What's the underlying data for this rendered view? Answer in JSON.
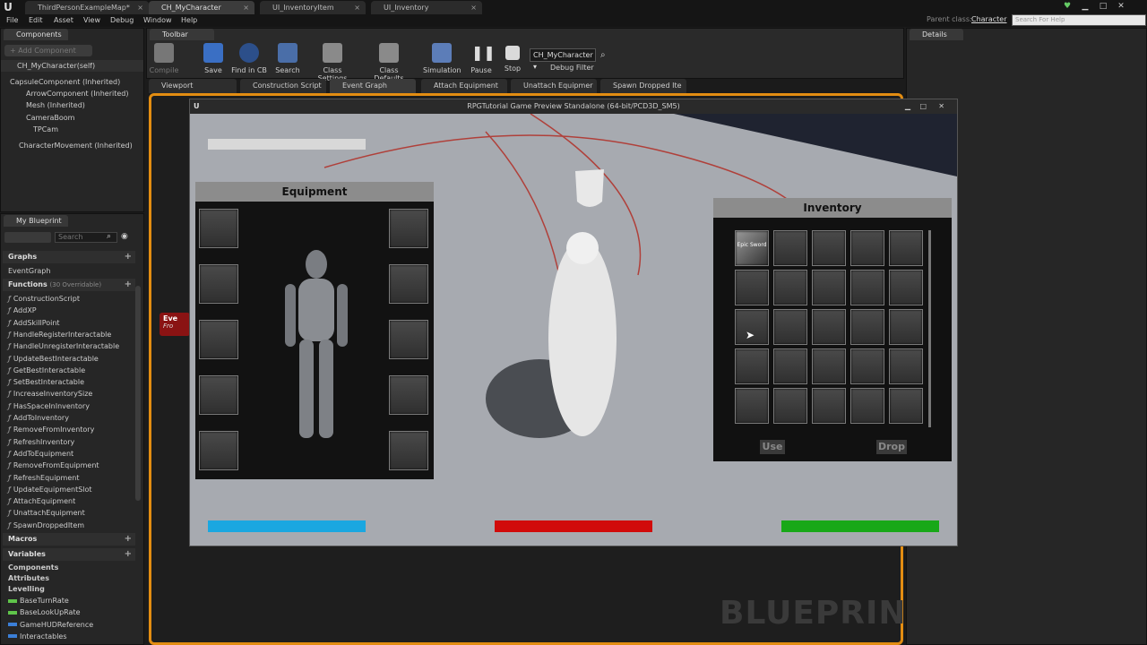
{
  "app": {
    "doc_tabs": [
      "ThirdPersonExampleMap*",
      "CH_MyCharacter",
      "UI_InventoryItem",
      "UI_Inventory"
    ],
    "menu": [
      "File",
      "Edit",
      "Asset",
      "View",
      "Debug",
      "Window",
      "Help"
    ],
    "parent_class_label": "Parent class:",
    "parent_class_value": "Character",
    "help_search_placeholder": "Search For Help"
  },
  "components_panel": {
    "tab": "Components",
    "add_button": "+ Add Component",
    "self_item": "CH_MyCharacter(self)",
    "tree": [
      {
        "label": "CapsuleComponent (Inherited)"
      },
      {
        "label": "ArrowComponent (Inherited)"
      },
      {
        "label": "Mesh (Inherited)"
      },
      {
        "label": "CameraBoom"
      },
      {
        "label": "TPCam"
      },
      {
        "label": "CharacterMovement (Inherited)"
      }
    ]
  },
  "toolbar": {
    "tab": "Toolbar",
    "buttons": [
      "Compile",
      "Save",
      "Find in CB",
      "Search",
      "Class Settings",
      "Class Defaults",
      "Simulation",
      "Pause",
      "Stop"
    ],
    "debug_select": "CH_MyCharacter",
    "debug_filter": "Debug Filter"
  },
  "graph_tabs": [
    "Viewport",
    "Construction Script",
    "Event Graph",
    "Attach Equipment",
    "Unattach Equipmer",
    "Spawn Dropped Ite"
  ],
  "details_panel": {
    "tab": "Details"
  },
  "my_blueprint": {
    "tab": "My Blueprint",
    "search_placeholder": "Search",
    "graphs_header": "Graphs",
    "graphs": [
      "EventGraph"
    ],
    "functions_header": "Functions",
    "functions_count": "(30 Overridable)",
    "functions": [
      "ConstructionScript",
      "AddXP",
      "AddSkillPoint",
      "HandleRegisterInteractable",
      "HandleUnregisterInteractable",
      "UpdateBestInteractable",
      "GetBestInteractable",
      "SetBestInteractable",
      "IncreaseInventorySize",
      "HasSpaceInInventory",
      "AddToInventory",
      "RemoveFromInventory",
      "RefreshInventory",
      "AddToEquipment",
      "RemoveFromEquipment",
      "RefreshEquipment",
      "UpdateEquipmentSlot",
      "AttachEquipment",
      "UnattachEquipment",
      "SpawnDroppedItem"
    ],
    "macros_header": "Macros",
    "variables_header": "Variables",
    "variable_groups": [
      "Components",
      "Attributes",
      "Levelling"
    ],
    "variables": [
      {
        "name": "BaseTurnRate",
        "color": "#5fc44a"
      },
      {
        "name": "BaseLookUpRate",
        "color": "#5fc44a"
      },
      {
        "name": "GameHUDReference",
        "color": "#3b7fd8"
      },
      {
        "name": "Interactables",
        "color": "#3b7fd8"
      }
    ]
  },
  "graph": {
    "event_node_title": "Eve",
    "event_node_sub": "Fro",
    "watermark": "BLUEPRINT"
  },
  "game_window": {
    "title": "RPGTutorial Game Preview Standalone (64-bit/PCD3D_SM5)",
    "equipment_title": "Equipment",
    "inventory_title": "Inventory",
    "inventory_item_label": "Epic Sword",
    "use_button": "Use",
    "drop_button": "Drop",
    "bars": {
      "health_color": "#d10b0b",
      "mana_color": "#1aa7e0",
      "stamina_color": "#18a818"
    }
  }
}
